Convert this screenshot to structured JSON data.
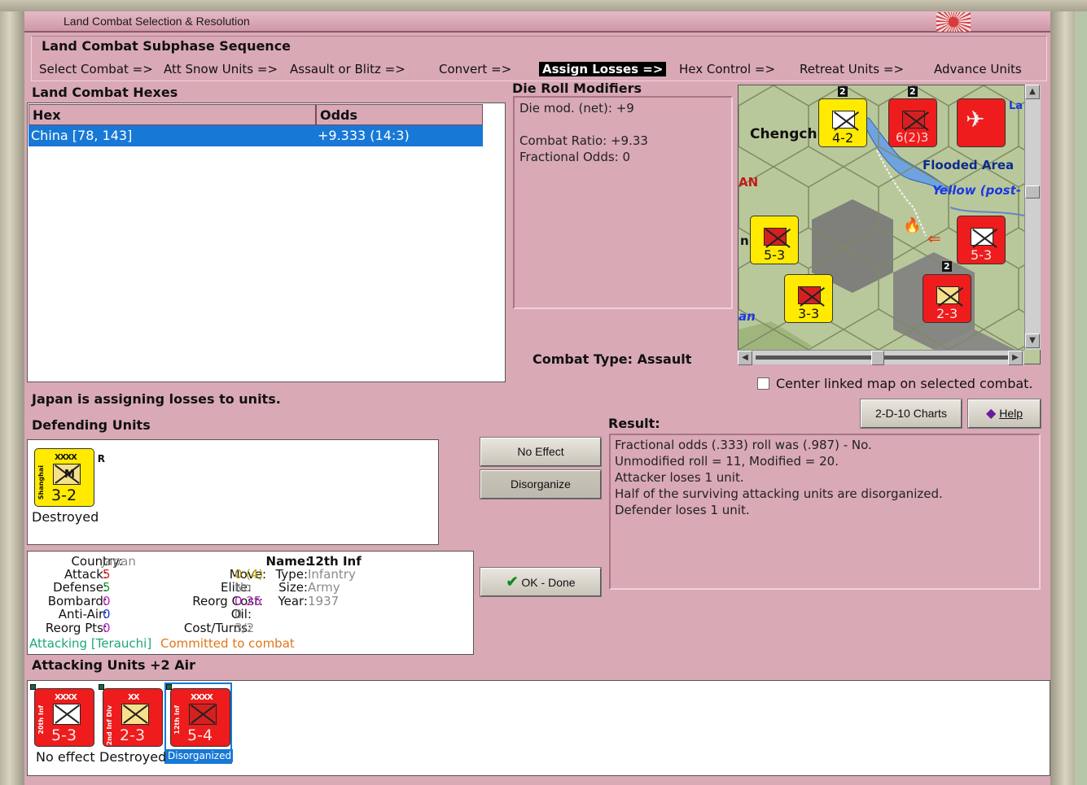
{
  "window": {
    "title": "Land Combat Selection & Resolution"
  },
  "subphase": {
    "title": "Land Combat Subphase Sequence",
    "steps": [
      {
        "label": "Select Combat =>",
        "active": false
      },
      {
        "label": "Att Snow Units =>",
        "active": false
      },
      {
        "label": "Assault or Blitz =>",
        "active": false
      },
      {
        "label": "Convert =>",
        "active": false
      },
      {
        "label": "Assign Losses =>",
        "active": true
      },
      {
        "label": "Hex Control =>",
        "active": false
      },
      {
        "label": "Retreat Units =>",
        "active": false
      },
      {
        "label": "Advance Units",
        "active": false
      }
    ]
  },
  "hexes": {
    "title": "Land Combat Hexes",
    "columns": [
      "Hex",
      "Odds"
    ],
    "rows": [
      {
        "hex": "China [78, 143]",
        "odds": "+9.333 (14:3)"
      }
    ]
  },
  "die_roll": {
    "title": "Die Roll Modifiers",
    "lines": [
      "Die mod. (net): +9",
      "",
      "Combat Ratio: +9.33",
      "Fractional Odds: 0"
    ]
  },
  "combat_type": "Combat Type:  Assault",
  "map": {
    "labels": [
      "Chengch",
      "Flooded Area",
      "Yellow (post-",
      "La",
      "AN",
      "an",
      "n"
    ],
    "counters": [
      {
        "str": "4-2",
        "color": "yellow"
      },
      {
        "str": "6(2)3",
        "color": "red"
      },
      {
        "str": "5-3",
        "color": "yellow"
      },
      {
        "str": "5-3",
        "color": "red"
      },
      {
        "str": "3-3",
        "color": "yellow"
      },
      {
        "str": "2-3",
        "color": "red"
      }
    ],
    "stack_counts": [
      "2",
      "2",
      "2"
    ]
  },
  "center_linked": "Center linked map on selected combat.",
  "buttons": {
    "charts": "2-D-10 Charts",
    "help": "Help",
    "no_effect": "No Effect",
    "disorganize": "Disorganize",
    "ok_done": "OK - Done"
  },
  "status_message": "Japan is assigning losses to units.",
  "defending": {
    "title": "Defending Units",
    "units": [
      {
        "name": "Shanghai",
        "size": "XXXX",
        "mark": "R",
        "type_letter": "M",
        "strength": "3-2",
        "status": "Destroyed"
      }
    ]
  },
  "result": {
    "title": "Result:",
    "lines": [
      "Fractional odds (.333) roll was (.987)  - No.",
      "Unmodified roll = 11, Modified = 20.",
      "Attacker loses 1 unit.",
      "Half of the surviving attacking units are disorganized.",
      "Defender loses 1 unit."
    ]
  },
  "unit_info": {
    "country_label": "Country:",
    "country": "Japan",
    "attack_label": "Attack:",
    "attack": "5",
    "defense_label": "Defense:",
    "defense": "5",
    "bombard_label": "Bombard:",
    "bombard": "0",
    "antiair_label": "Anti-Air:",
    "antiair": "0",
    "reorg_pts_label": "Reorg Pts:",
    "reorg_pts": "0",
    "name_label": "Name:",
    "name": "12th Inf",
    "move_label": "Move:",
    "move": "0",
    "move_extra": "(4)",
    "type_label": "Type:",
    "type": "Infantry",
    "elite_label": "Elite:",
    "elite": "No",
    "size_label": "Size:",
    "size": "Army",
    "reorg_cost_label": "Reorg Cost:",
    "reorg_cost": "0.25",
    "year_label": "Year:",
    "year": "1937",
    "oil_label": "Oil:",
    "oil": "0",
    "cost_label": "Cost/Turns:",
    "cost": "3/2",
    "attacking": "Attacking [Terauchi]",
    "committed": "Committed to combat"
  },
  "attacking": {
    "title": "Attacking Units +2 Air",
    "units": [
      {
        "name": "20th Inf",
        "size": "XXXX",
        "strength": "5-3",
        "status": "No effect"
      },
      {
        "name": "2nd Inf Div",
        "size": "XX",
        "strength": "2-3",
        "status": "Destroyed"
      },
      {
        "name": "12th Inf",
        "size": "XXXX",
        "strength": "5-4",
        "status": "Disorganized"
      }
    ]
  },
  "colors": {
    "panel_bg": "#d9a9b6",
    "selection": "#1878d6",
    "unit_yellow": "#ffea00",
    "unit_red": "#ee1c1c"
  }
}
